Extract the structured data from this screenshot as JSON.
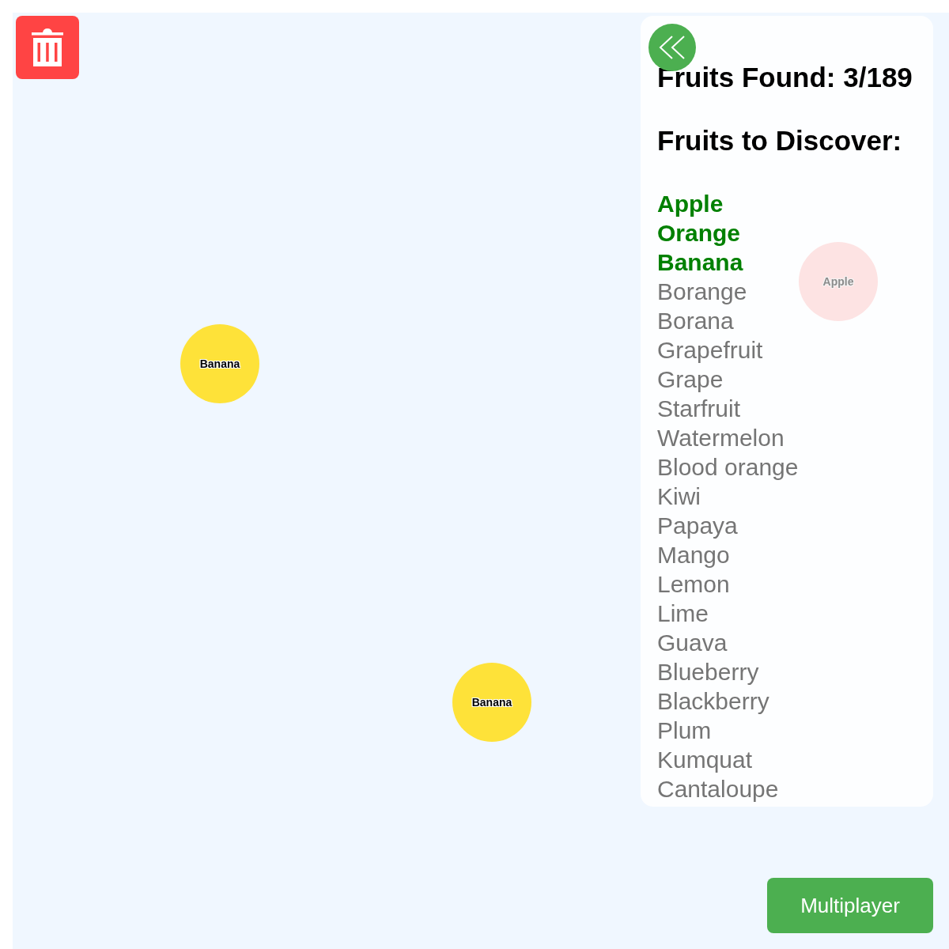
{
  "panel": {
    "found_count": "Fruits Found: 3/189",
    "heading": "Fruits to Discover:",
    "fruits": [
      {
        "name": "Apple",
        "found": true
      },
      {
        "name": "Orange",
        "found": true
      },
      {
        "name": "Banana",
        "found": true
      },
      {
        "name": "Borange",
        "found": false
      },
      {
        "name": "Borana",
        "found": false
      },
      {
        "name": "Grapefruit",
        "found": false
      },
      {
        "name": "Grape",
        "found": false
      },
      {
        "name": "Starfruit",
        "found": false
      },
      {
        "name": "Watermelon",
        "found": false
      },
      {
        "name": "Blood orange",
        "found": false
      },
      {
        "name": "Kiwi",
        "found": false
      },
      {
        "name": "Papaya",
        "found": false
      },
      {
        "name": "Mango",
        "found": false
      },
      {
        "name": "Lemon",
        "found": false
      },
      {
        "name": "Lime",
        "found": false
      },
      {
        "name": "Guava",
        "found": false
      },
      {
        "name": "Blueberry",
        "found": false
      },
      {
        "name": "Blackberry",
        "found": false
      },
      {
        "name": "Plum",
        "found": false
      },
      {
        "name": "Kumquat",
        "found": false
      },
      {
        "name": "Cantaloupe",
        "found": false
      }
    ]
  },
  "bubbles": [
    {
      "label": "Apple",
      "color": "#fde3e3",
      "faded": true
    },
    {
      "label": "Banana",
      "color": "#fee239",
      "faded": false
    },
    {
      "label": "Banana",
      "color": "#fee239",
      "faded": false
    }
  ],
  "multiplayer_button": {
    "label": "Multiplayer"
  }
}
